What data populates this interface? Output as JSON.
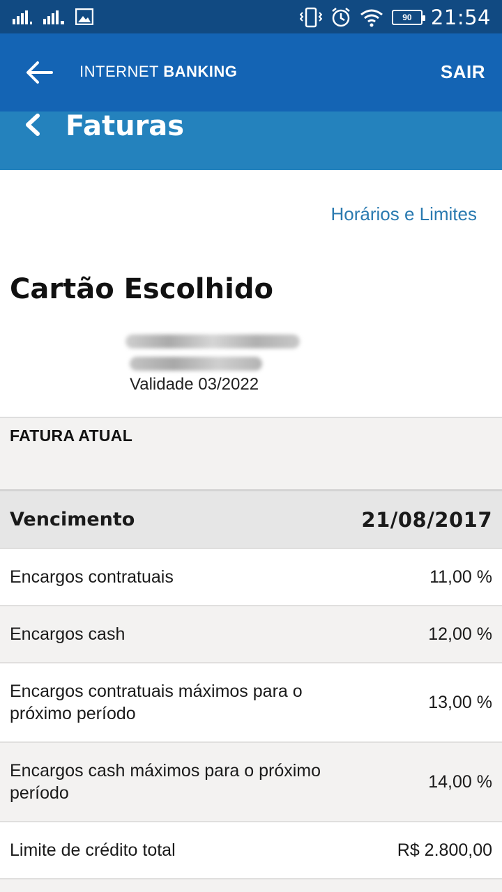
{
  "status_bar": {
    "time": "21:54",
    "battery": "90",
    "icons": [
      "signal-icon",
      "signal-2-icon",
      "image-icon",
      "vibrate-icon",
      "alarm-icon",
      "wifi-icon",
      "battery-icon"
    ]
  },
  "app_bar": {
    "brand_light": "INTERNET ",
    "brand_bold": "BANKING",
    "logout_label": "SAIR"
  },
  "sub_header": {
    "title": "Faturas"
  },
  "links": {
    "horarios": "Horários e Limites"
  },
  "card": {
    "title": "Cartão Escolhido",
    "validade": "Validade 03/2022"
  },
  "fatura": {
    "section_label": "FATURA ATUAL",
    "vencimento_label": "Vencimento",
    "vencimento_value": "21/08/2017",
    "rows": [
      {
        "label": "Encargos contratuais",
        "value": "11,00 %"
      },
      {
        "label": "Encargos cash",
        "value": "12,00 %"
      },
      {
        "label": "Encargos contratuais máximos para o próximo período",
        "value": "13,00 %"
      },
      {
        "label": "Encargos cash máximos para o próximo período",
        "value": "14,00 %"
      },
      {
        "label": "Limite de crédito total",
        "value": "R$ 2.800,00"
      }
    ]
  },
  "colors": {
    "status_bar": "#114a82",
    "app_bar": "#1464b4",
    "sub_header": "#2482bd",
    "link": "#2a7ab0"
  }
}
